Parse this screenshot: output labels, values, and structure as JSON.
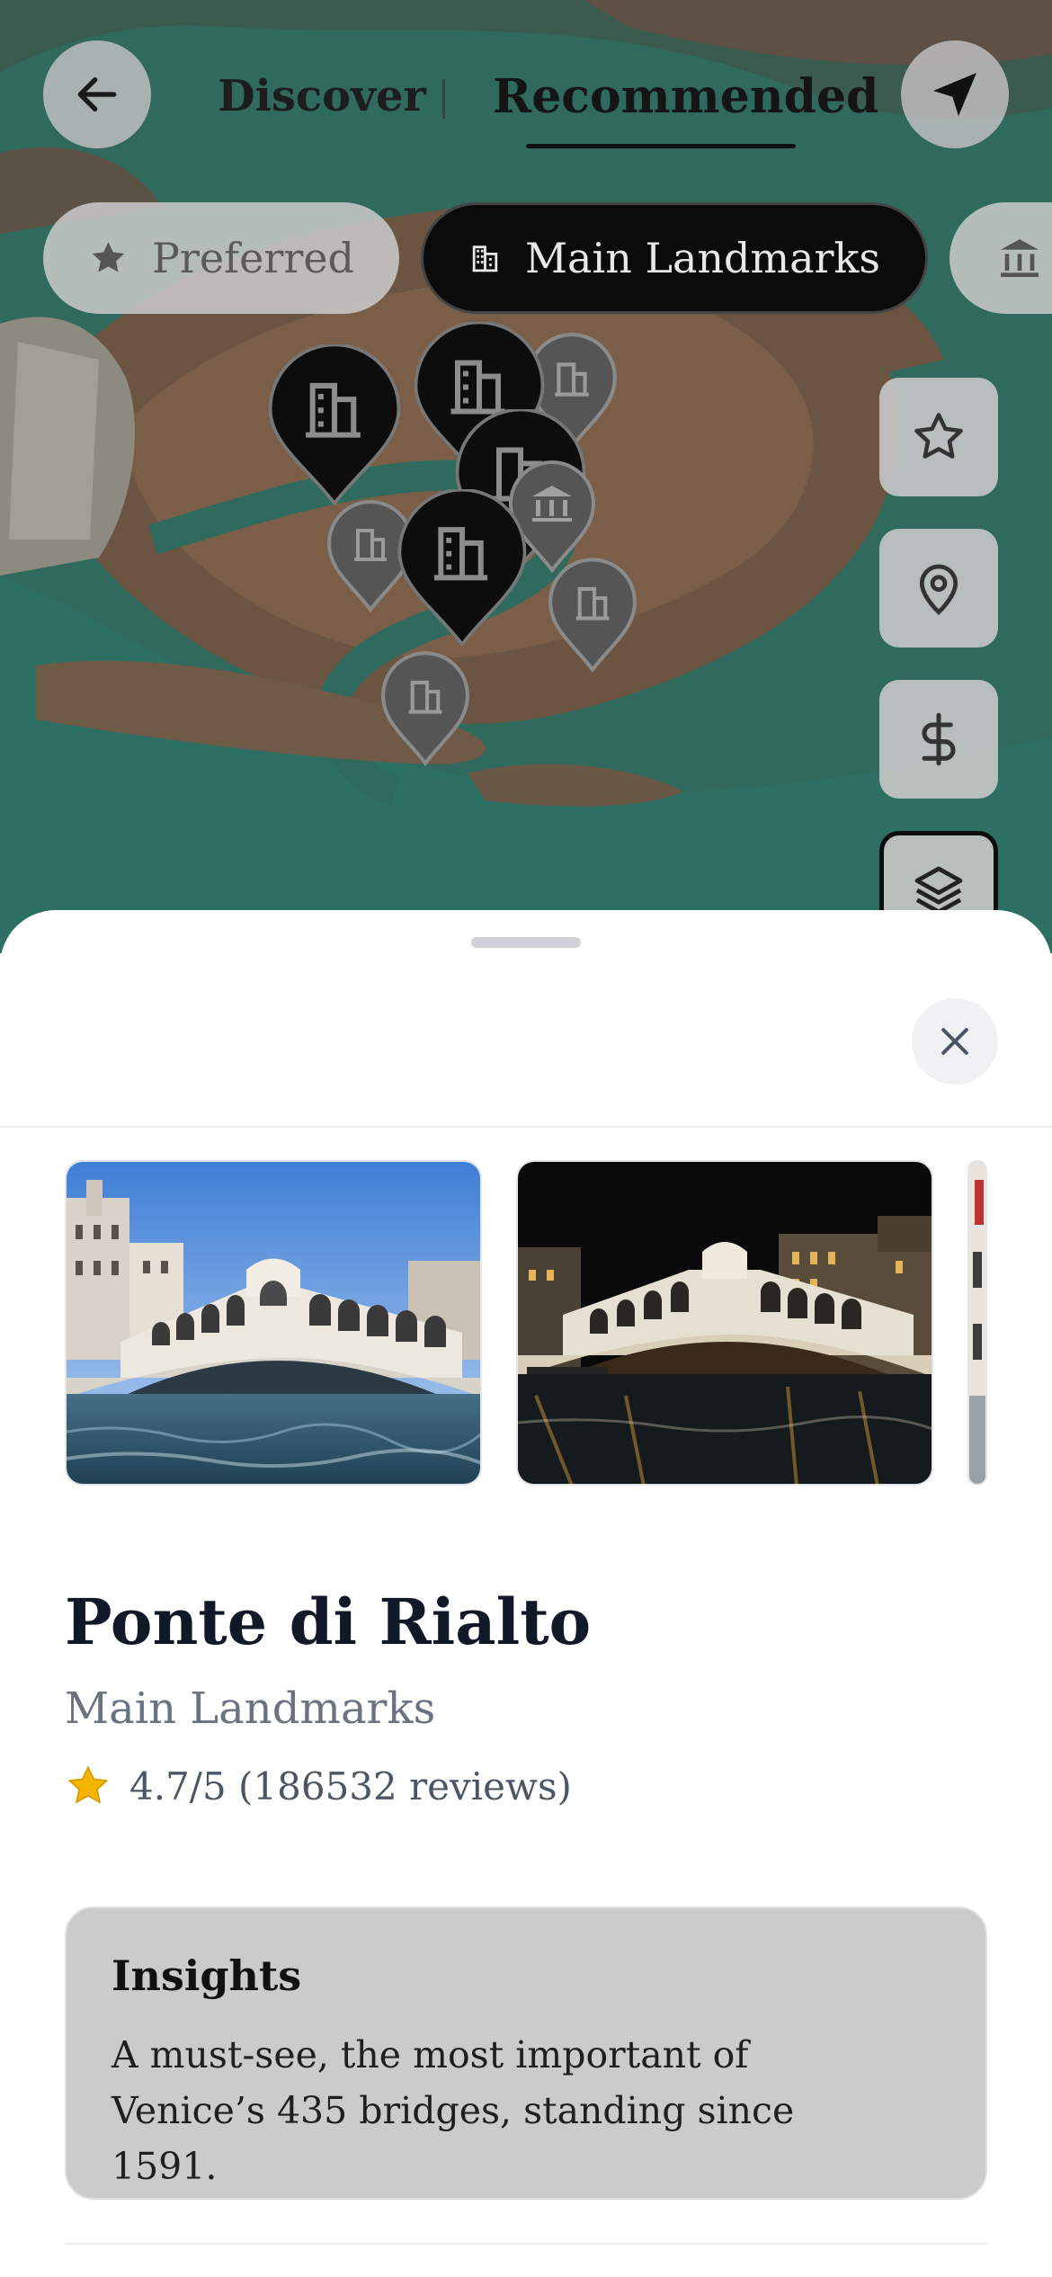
{
  "top_bar": {
    "tabs": [
      {
        "label": "Discover",
        "active": false
      },
      {
        "label": "Recommended",
        "active": true
      }
    ]
  },
  "filters": {
    "chips": [
      {
        "label": "Preferred",
        "icon": "star-icon",
        "selected": false
      },
      {
        "label": "Main Landmarks",
        "icon": "building-icon",
        "selected": true
      },
      {
        "label": "",
        "icon": "museum-icon",
        "selected": false
      }
    ]
  },
  "map_controls": [
    "star-icon",
    "location-pin-icon",
    "dollar-icon",
    "layers-icon"
  ],
  "place": {
    "title": "Ponte di Rialto",
    "category": "Main Landmarks",
    "rating_text": "4.7/5 (186532 reviews)",
    "rating": 4.7,
    "reviews": 186532
  },
  "insights": {
    "title": "Insights",
    "body": "A must-see, the most important of Venice’s 435 bridges, standing since 1591."
  },
  "colors": {
    "selected_chip": "#0b0b0b",
    "insights_card": "#cbcbcb",
    "title_text": "#111827",
    "category_text": "#6b7280",
    "star": "#f5b400"
  }
}
